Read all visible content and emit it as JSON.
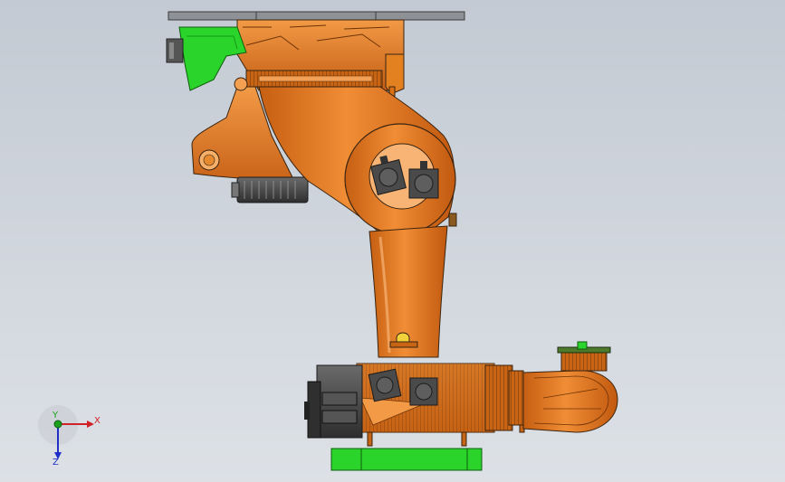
{
  "viewport": {
    "description_visible_text": "",
    "background_top": "#c3cad3",
    "background_bottom": "#dde1e6"
  },
  "model": {
    "colors": {
      "robot_orange": "#e9781c",
      "robot_orange_dark": "#b8560f",
      "robot_orange_light": "#f39a47",
      "motor_dark": "#3e3e3e",
      "motor_mid": "#6b6b6b",
      "green_part": "#2bd42b",
      "green_dark": "#159a15",
      "plate_gray": "#8c8f93",
      "outline": "#3a2410"
    }
  },
  "triad": {
    "x_label": "X",
    "y_label": "Y",
    "z_label": "Z",
    "x_color": "#d0202a",
    "y_color": "#1aa01a",
    "z_color": "#2030c8"
  }
}
